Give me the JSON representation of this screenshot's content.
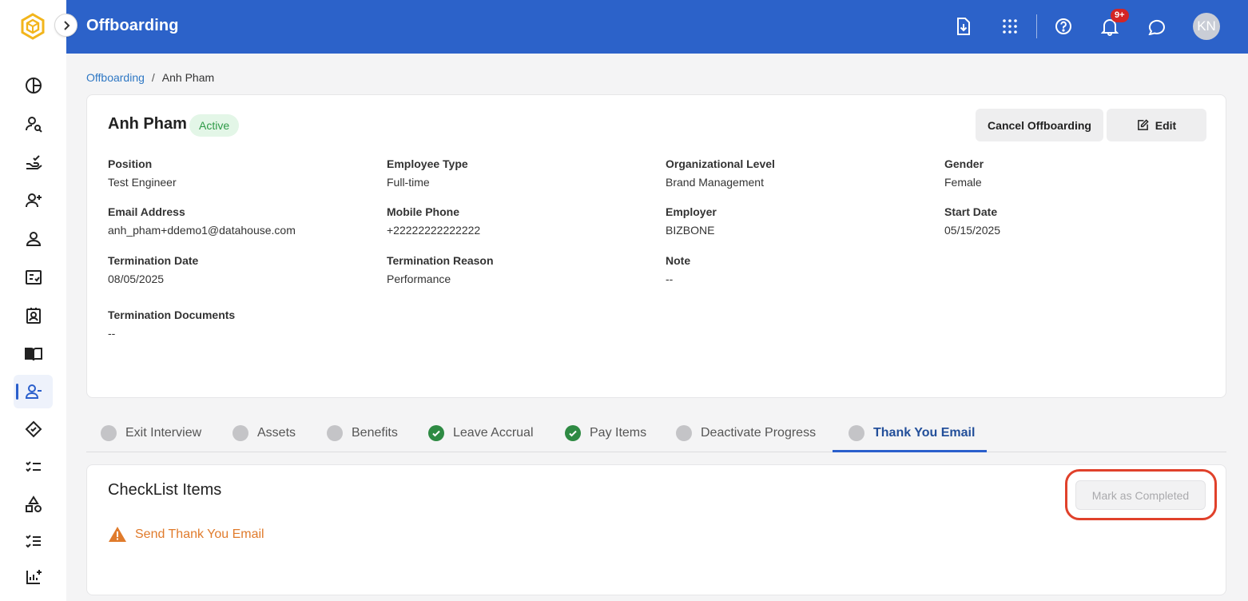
{
  "app": {
    "title": "Offboarding",
    "user_initials": "KN",
    "notification_count": "9+"
  },
  "breadcrumb": {
    "parent": "Offboarding",
    "separator": "/",
    "current": "Anh Pham"
  },
  "employee": {
    "name": "Anh Pham",
    "status": "Active",
    "fields": [
      {
        "label": "Position",
        "value": "Test Engineer"
      },
      {
        "label": "Employee Type",
        "value": "Full-time"
      },
      {
        "label": "Organizational Level",
        "value": "Brand Management"
      },
      {
        "label": "Gender",
        "value": "Female"
      },
      {
        "label": "Email Address",
        "value": "anh_pham+ddemo1@datahouse.com"
      },
      {
        "label": "Mobile Phone",
        "value": "+22222222222222"
      },
      {
        "label": "Employer",
        "value": "BIZBONE"
      },
      {
        "label": "Start Date",
        "value": "05/15/2025"
      },
      {
        "label": "Termination Date",
        "value": "08/05/2025"
      },
      {
        "label": "Termination Reason",
        "value": "Performance"
      },
      {
        "label": "Note",
        "value": "--"
      },
      {
        "label": "Termination Documents",
        "value": "--"
      }
    ]
  },
  "actions": {
    "cancel_label": "Cancel Offboarding",
    "edit_label": "Edit"
  },
  "tabs": [
    {
      "label": "Exit Interview",
      "state": "pending"
    },
    {
      "label": "Assets",
      "state": "pending"
    },
    {
      "label": "Benefits",
      "state": "pending"
    },
    {
      "label": "Leave Accrual",
      "state": "done"
    },
    {
      "label": "Pay Items",
      "state": "done"
    },
    {
      "label": "Deactivate Progress",
      "state": "pending"
    },
    {
      "label": "Thank You Email",
      "state": "pending",
      "active": true
    }
  ],
  "checklist": {
    "title": "CheckList Items",
    "mark_label": "Mark as Completed",
    "items": [
      {
        "label": "Send Thank You Email",
        "icon": "warning-icon"
      }
    ]
  },
  "colors": {
    "brand": "#2c62c9",
    "done": "#2e8a43",
    "warning": "#e07b2c",
    "highlight": "#e0412b"
  }
}
